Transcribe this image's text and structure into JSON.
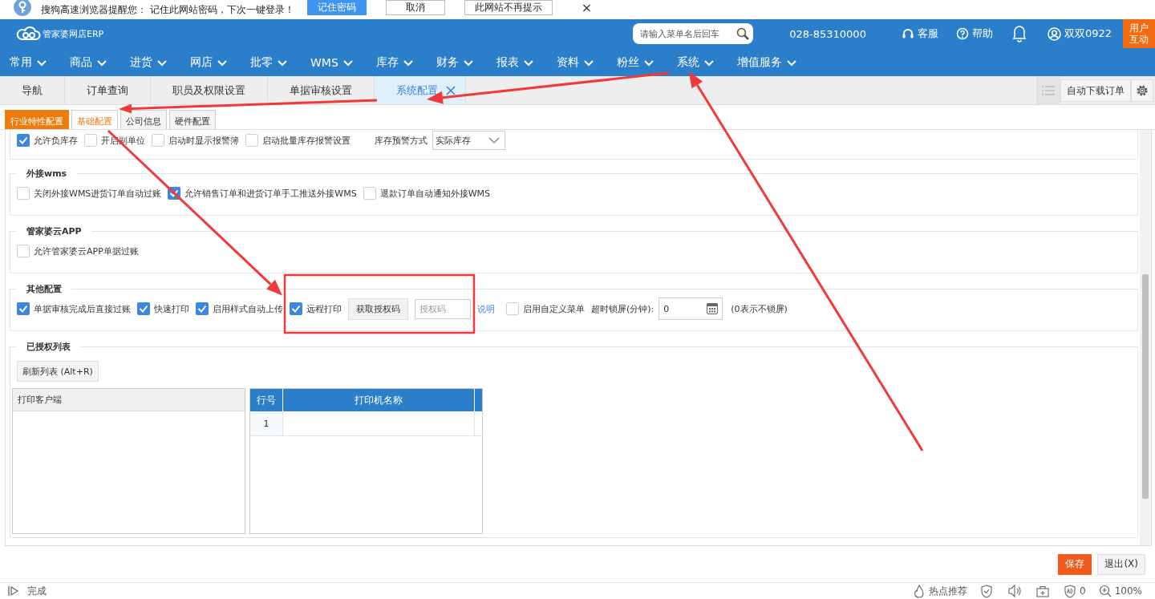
{
  "browser_prompt": {
    "message": "搜狗高速浏览器提醒您：  记住此网站密码，下次一键登录！",
    "buttons": [
      {
        "label": "记住密码",
        "kind": "primary"
      },
      {
        "label": "取消",
        "kind": "plain"
      },
      {
        "label": "此网站不再提示",
        "kind": "plain"
      }
    ],
    "close": "×"
  },
  "header": {
    "logo_text": "管家婆网店ERP",
    "search": {
      "placeholder": "请输入菜单名后回车"
    },
    "phone": "028-85310000",
    "service": "客服",
    "help": "帮助",
    "user": "双双0922",
    "interact": "用户互动"
  },
  "menu": [
    "常用",
    "商品",
    "进货",
    "网店",
    "批零",
    "WMS",
    "库存",
    "财务",
    "报表",
    "资料",
    "粉丝",
    "系统",
    "增值服务"
  ],
  "tabs": [
    {
      "label": "导航",
      "selected": false,
      "closable": false
    },
    {
      "label": "订单查询",
      "selected": false,
      "closable": false
    },
    {
      "label": "职员及权限设置",
      "selected": false,
      "closable": false
    },
    {
      "label": "单据审核设置",
      "selected": false,
      "closable": false
    },
    {
      "label": "系统配置",
      "selected": true,
      "closable": true
    }
  ],
  "auto_download": "自动下载订单",
  "subtabs": [
    {
      "label": "行业特性配置",
      "kind": "featured",
      "selected": false
    },
    {
      "label": "基础配置",
      "kind": "normal",
      "selected": true
    },
    {
      "label": "公司信息",
      "kind": "normal",
      "selected": false
    },
    {
      "label": "硬件配置",
      "kind": "normal",
      "selected": false
    }
  ],
  "groups": [
    {
      "items": [
        {
          "kind": "checkbox",
          "label": "允许负库存",
          "checked": true
        },
        {
          "kind": "checkbox",
          "label": "开启副单位",
          "checked": false
        },
        {
          "kind": "checkbox",
          "label": "启动时显示报警簿",
          "checked": false
        },
        {
          "kind": "checkbox",
          "label": "启动批量库存报警设置",
          "checked": false
        },
        {
          "kind": "select",
          "label": "库存预警方式",
          "value": "实际库存"
        }
      ]
    },
    {
      "title": "外接wms",
      "items": [
        {
          "kind": "checkbox",
          "label": "关闭外接WMS进货订单自动过账",
          "checked": false
        },
        {
          "kind": "checkbox",
          "label": "允许销售订单和进货订单手工推送外接WMS",
          "checked": true
        },
        {
          "kind": "checkbox",
          "label": "退款订单自动通知外接WMS",
          "checked": false
        }
      ]
    },
    {
      "title": "管家婆云APP",
      "items": [
        {
          "kind": "checkbox",
          "label": "允许管家婆云APP单据过账",
          "checked": false
        }
      ]
    },
    {
      "title": "其他配置",
      "items": [
        {
          "kind": "checkbox",
          "label": "单据审核完成后直接过账",
          "checked": true
        },
        {
          "kind": "checkbox",
          "label": "快速打印",
          "checked": true
        },
        {
          "kind": "checkbox",
          "label": "启用样式自动上传",
          "checked": true
        },
        {
          "kind": "checkbox",
          "label": "远程打印",
          "checked": true
        },
        {
          "kind": "button",
          "label": "获取授权码"
        },
        {
          "kind": "input",
          "placeholder": "授权码"
        },
        {
          "kind": "link",
          "label": "说明"
        },
        {
          "kind": "checkbox",
          "label": "启用自定义菜单",
          "checked": false
        },
        {
          "kind": "text",
          "label": "超时锁屏(分钟):"
        },
        {
          "kind": "number",
          "value": "0"
        },
        {
          "kind": "text",
          "label": "(0表示不锁屏)"
        }
      ]
    }
  ],
  "authorized": {
    "title": "已授权列表",
    "refresh": "刷新列表 (Alt+R)",
    "client_header": "打印客户端",
    "columns": [
      "行号",
      "打印机名称"
    ],
    "rows": [
      [
        "1",
        ""
      ]
    ]
  },
  "footer_buttons": [
    {
      "label": "保存",
      "kind": "primary"
    },
    {
      "label": "退出(X)",
      "kind": "plain"
    }
  ],
  "status_bar": {
    "left": "完成",
    "hot": "热点推荐",
    "ad_count": "0",
    "zoom": "100%"
  }
}
